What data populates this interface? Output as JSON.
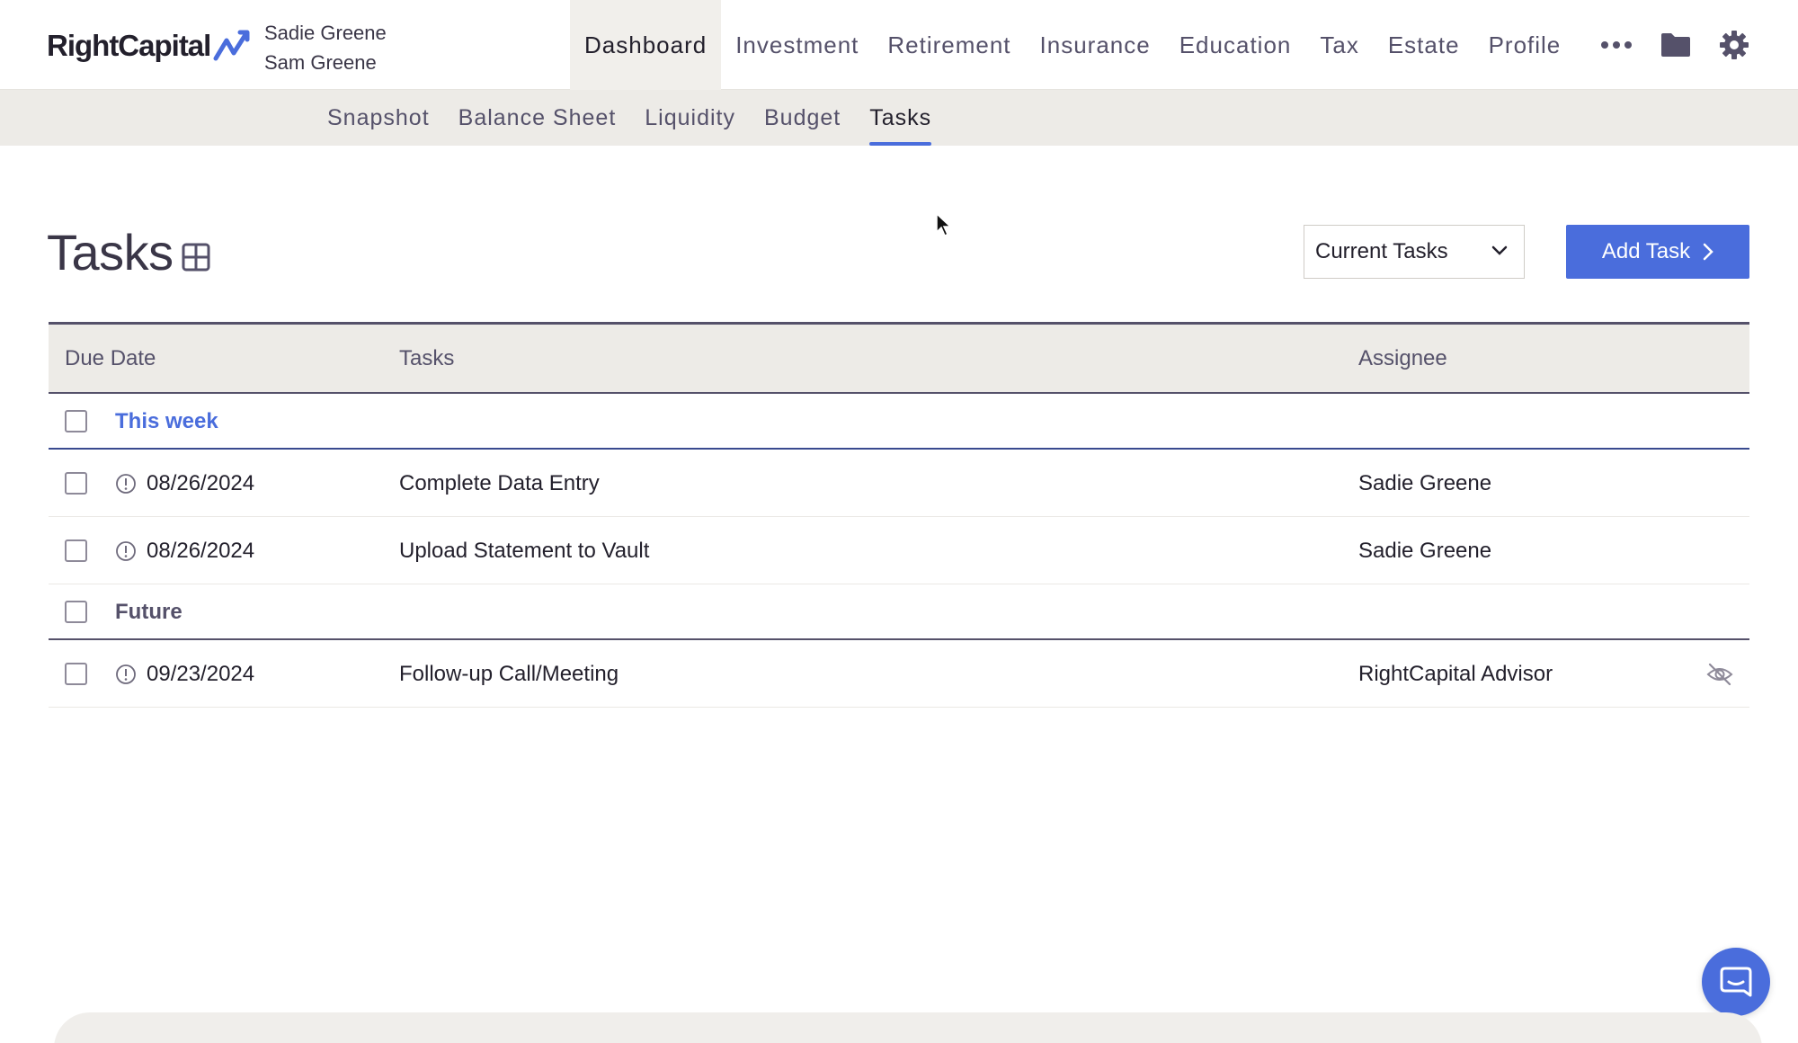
{
  "app": {
    "logo_text": "RightCapital",
    "clients": [
      "Sadie Greene",
      "Sam Greene"
    ]
  },
  "main_nav": {
    "items": [
      "Dashboard",
      "Investment",
      "Retirement",
      "Insurance",
      "Education",
      "Tax",
      "Estate",
      "Profile"
    ],
    "active": "Dashboard"
  },
  "sub_nav": {
    "items": [
      "Snapshot",
      "Balance Sheet",
      "Liquidity",
      "Budget",
      "Tasks"
    ],
    "active": "Tasks"
  },
  "page": {
    "title": "Tasks",
    "filter_value": "Current Tasks",
    "add_button_label": "Add Task"
  },
  "table": {
    "headers": {
      "due_date": "Due Date",
      "tasks": "Tasks",
      "assignee": "Assignee"
    },
    "groups": [
      {
        "label": "This week",
        "rows": [
          {
            "due": "08/26/2024",
            "task": "Complete Data Entry",
            "assignee": "Sadie Greene"
          },
          {
            "due": "08/26/2024",
            "task": "Upload Statement to Vault",
            "assignee": "Sadie Greene"
          }
        ]
      },
      {
        "label": "Future",
        "rows": [
          {
            "due": "09/23/2024",
            "task": "Follow-up Call/Meeting",
            "assignee": "RightCapital Advisor",
            "hidden_icon": "eye-slash-icon"
          }
        ]
      }
    ]
  },
  "colors": {
    "accent": "#4a6ddc",
    "header_gray": "#edebe7",
    "text_dark": "#23202c"
  },
  "icons": [
    "more-icon",
    "folder-icon",
    "gear-icon",
    "grid-icon",
    "chevron-down-icon",
    "chevron-right-icon",
    "clock-alert-icon",
    "eye-slash-icon",
    "chat-icon"
  ]
}
